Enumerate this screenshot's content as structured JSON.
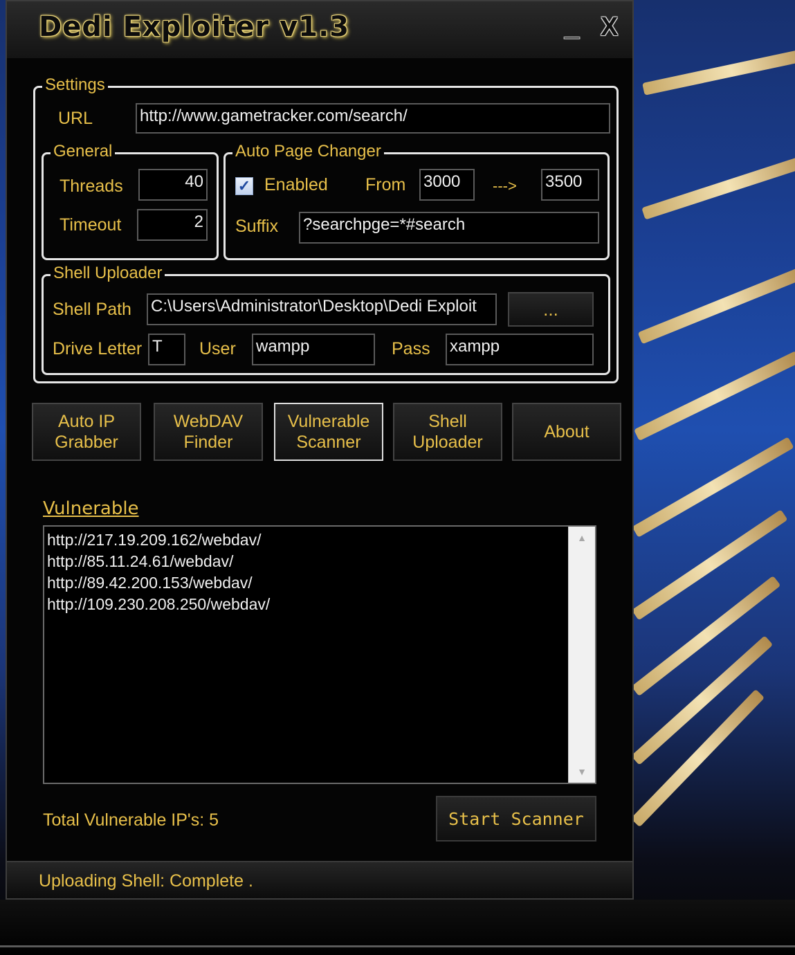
{
  "window": {
    "title": "Dedi Exploiter v1.3",
    "minimize_label": "_",
    "close_label": "X"
  },
  "settings": {
    "group_label": "Settings",
    "url_label": "URL",
    "url_value": "http://www.gametracker.com/search/",
    "general": {
      "group_label": "General",
      "threads_label": "Threads",
      "threads_value": "40",
      "timeout_label": "Timeout",
      "timeout_value": "2"
    },
    "auto_page_changer": {
      "group_label": "Auto Page Changer",
      "enabled_label": "Enabled",
      "enabled_checked": "✓",
      "from_label": "From",
      "from_value": "3000",
      "arrow_label": "--->",
      "to_value": "3500",
      "suffix_label": "Suffix",
      "suffix_value": "?searchpge=*#search"
    },
    "shell_uploader": {
      "group_label": "Shell Uploader",
      "shell_path_label": "Shell Path",
      "shell_path_value": "C:\\Users\\Administrator\\Desktop\\Dedi Exploit",
      "browse_label": "...",
      "drive_letter_label": "Drive Letter",
      "drive_letter_value": "T",
      "user_label": "User",
      "user_value": "wampp",
      "pass_label": "Pass",
      "pass_value": "xampp"
    }
  },
  "nav_buttons": [
    {
      "line1": "Auto IP",
      "line2": "Grabber"
    },
    {
      "line1": "WebDAV",
      "line2": "Finder"
    },
    {
      "line1": "Vulnerable",
      "line2": "Scanner"
    },
    {
      "line1": "Shell",
      "line2": "Uploader"
    },
    {
      "line1": "About",
      "line2": ""
    }
  ],
  "vulnerable": {
    "section_label": "Vulnerable",
    "items": [
      "http://217.19.209.162/webdav/",
      "http://85.11.24.61/webdav/",
      "http://89.42.200.153/webdav/",
      "http://109.230.208.250/webdav/"
    ],
    "total_label": "Total Vulnerable IP's: 5",
    "start_button_label": "Start  Scanner"
  },
  "status": {
    "text": "Uploading Shell: Complete ."
  },
  "colors": {
    "accent_text": "#e8c04a",
    "field_bg": "#000000",
    "window_bg": "#050505"
  }
}
